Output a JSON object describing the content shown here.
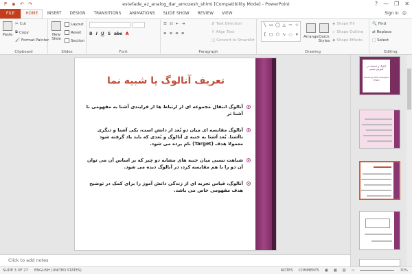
{
  "window": {
    "title": "estefade_az_analog_dar_amozesh_shimi [Compatibility Mode] - PowerPoint",
    "sign_in": "Sign in",
    "help": "?",
    "minimize": "—",
    "restore": "❐",
    "close": "✕"
  },
  "tabs": [
    "FILE",
    "HOME",
    "INSERT",
    "DESIGN",
    "TRANSITIONS",
    "ANIMATIONS",
    "SLIDE SHOW",
    "REVIEW",
    "VIEW"
  ],
  "ribbon": {
    "clipboard": {
      "label": "Clipboard",
      "paste": "Paste",
      "cut": "Cut",
      "copy": "Copy",
      "format_painter": "Format Painter"
    },
    "slides": {
      "label": "Slides",
      "new_slide": "New Slide",
      "layout": "Layout",
      "reset": "Reset",
      "section": "Section"
    },
    "font": {
      "label": "Font"
    },
    "paragraph": {
      "label": "Paragraph",
      "text_direction": "Text Direction",
      "align_text": "Align Text",
      "convert": "Convert to SmartArt"
    },
    "drawing": {
      "label": "Drawing",
      "arrange": "Arrange",
      "quick_styles": "Quick Styles",
      "shape_fill": "Shape Fill",
      "shape_outline": "Shape Outline",
      "shape_effects": "Shape Effects"
    },
    "editing": {
      "label": "Editing",
      "find": "Find",
      "replace": "Replace",
      "select": "Select"
    }
  },
  "slide": {
    "title": "تعریف آنالوگ یا شبیه نما",
    "bullets": [
      "آنالوگ انتقال مجموعه ای از ارتباط ها از فرایندی آشنا به مفهومی نا آشنا تر",
      "آنالوگ مقایسه ای میان دو بُعد از دانش است، یکی آشنا و دیگری ناآشنا. بُعد آشنا به جنبه ی آنالوگ و بُعدی که باید یاد گرفته شود معمولا هدف (Target) نام برده می شود.",
      "شباهت نسبی میان جنبه های مشابه دو چیز که بر اساس آن می توان آن دو را با هم مقایسه کرد، در آنالوگ دیده می شود.",
      "آنالوگ، قیاس تجربه ای از زندگی دانش آموز را برای کمک در توضیح هدف مفهومی خاص می باشد."
    ]
  },
  "thumbnails": [
    {
      "num": "1",
      "title": "آنالوگ و استفاده در آموزش شیمی",
      "subtitle": "Teaching With Analogies (TWA)"
    },
    {
      "num": "2"
    },
    {
      "num": "3"
    },
    {
      "num": "4"
    },
    {
      "num": "5"
    }
  ],
  "notes_placeholder": "Click to add notes",
  "status": {
    "slide_of": "SLIDE 3 OF 27",
    "language": "ENGLISH (UNITED STATES)",
    "notes": "NOTES",
    "comments": "COMMENTS",
    "zoom": "70%"
  }
}
